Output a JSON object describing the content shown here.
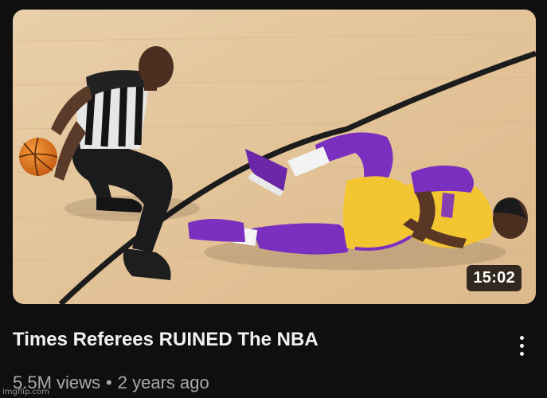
{
  "video": {
    "title": "Times Referees RUINED The NBA",
    "views": "5.5M views",
    "separator": "•",
    "age": "2 years ago",
    "duration": "15:02",
    "menu_icon": "more-vert-icon"
  },
  "watermark": "imgflip.com",
  "colors": {
    "background": "#0f0f0f",
    "title": "#f1f1f1",
    "meta": "#aaaaaa",
    "court": "#e2c39c",
    "lakers_gold": "#f2c531",
    "lakers_purple": "#7b2fbf"
  }
}
